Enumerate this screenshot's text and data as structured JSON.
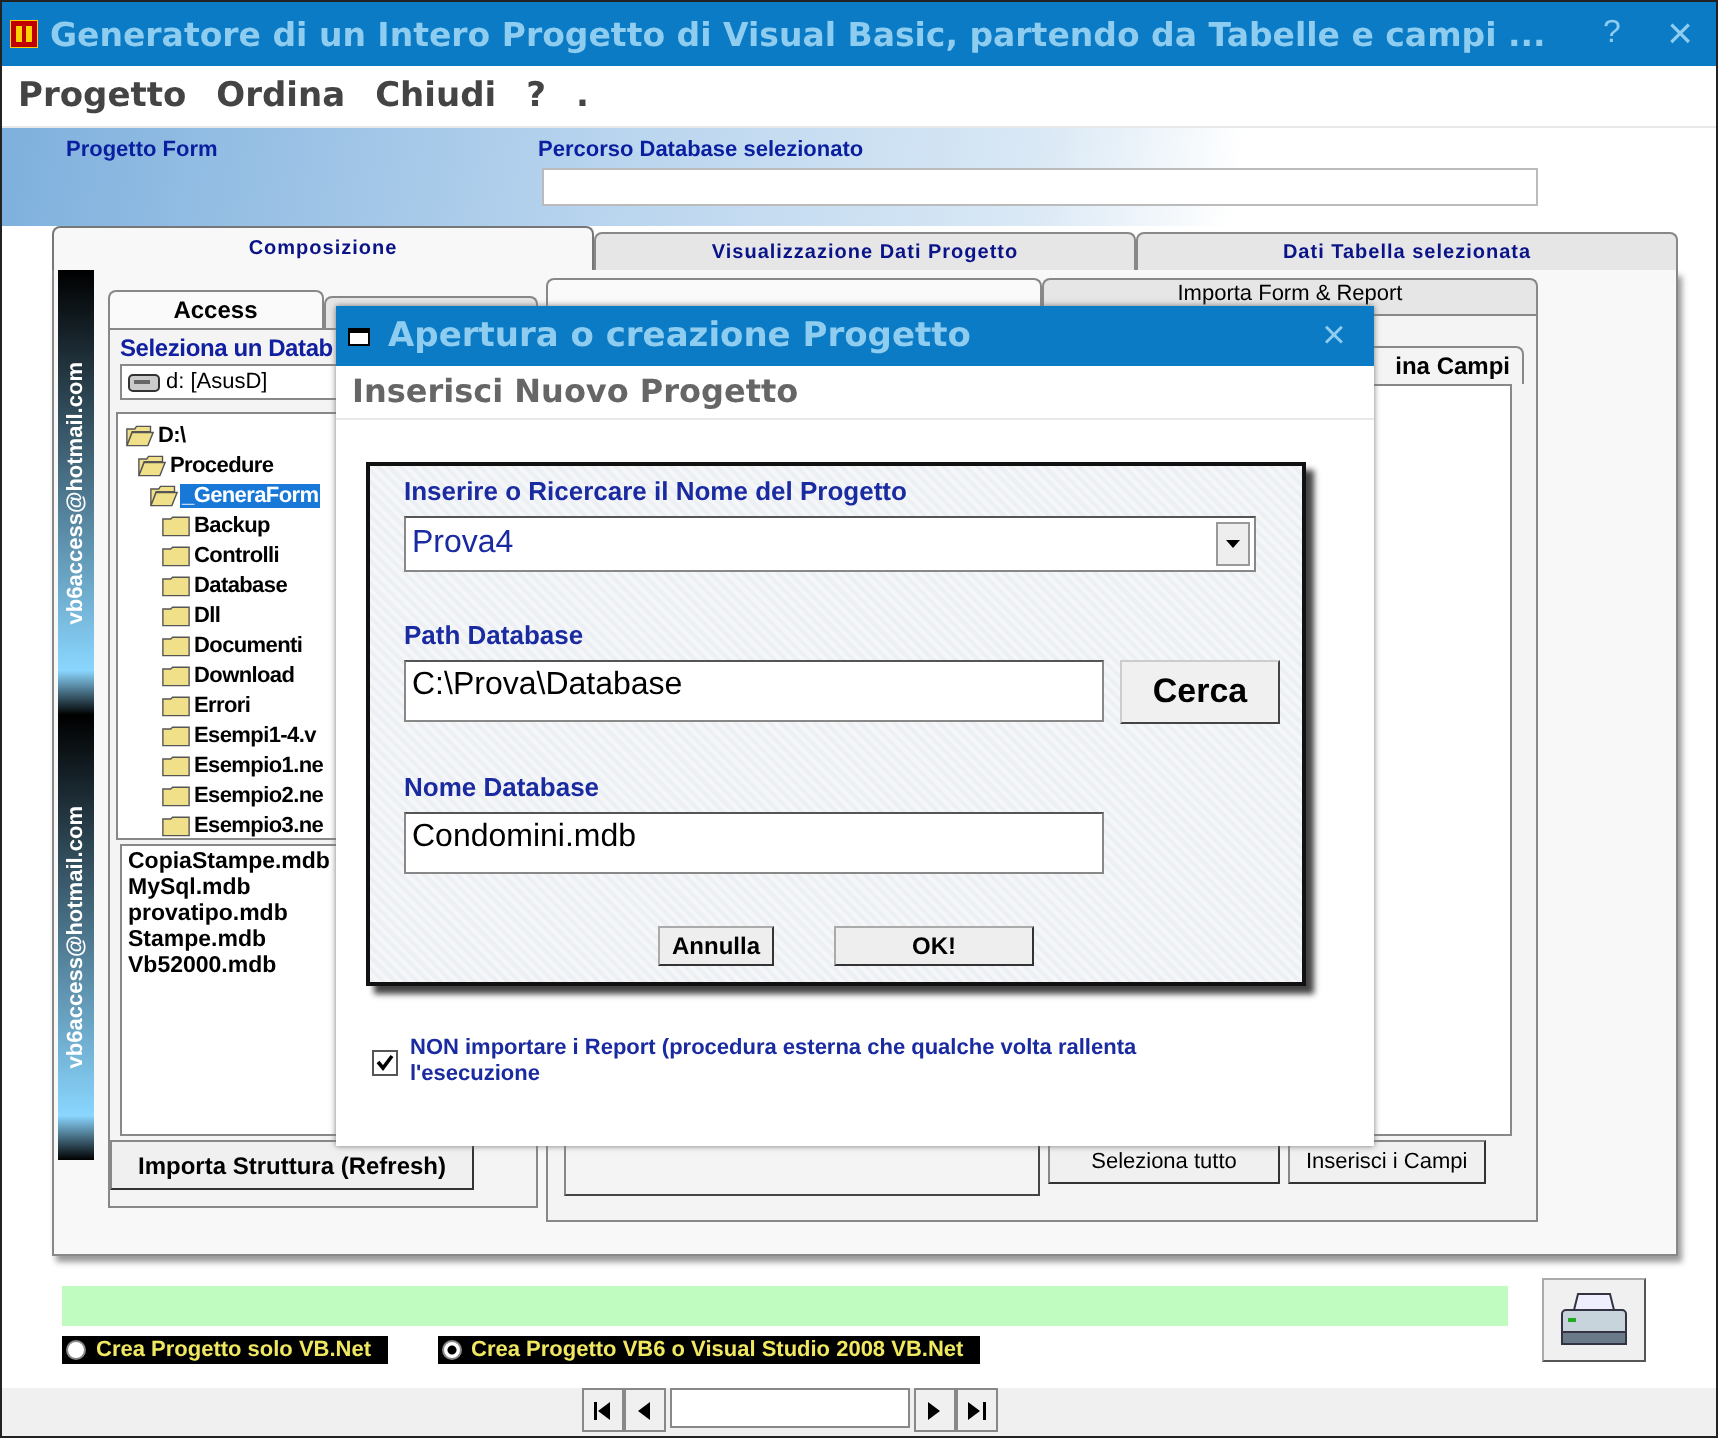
{
  "window": {
    "title": "Generatore di un Intero Progetto di Visual Basic, partendo da Tabelle e campi ...",
    "help": "?",
    "close": "×"
  },
  "menu": [
    {
      "label": "Progetto"
    },
    {
      "label": "Ordina"
    },
    {
      "label": "Chiudi"
    },
    {
      "label": "?"
    },
    {
      "label": "."
    }
  ],
  "form_label": "Progetto Form",
  "database_path": {
    "label": "Percorso Database selezionato"
  },
  "tabs": [
    {
      "label": "Composizione",
      "selected": true
    },
    {
      "label": "Visualizzazione Dati Progetto",
      "selected": false
    },
    {
      "label": "Dati Tabella selezionata",
      "selected": false
    }
  ],
  "side_strip": [
    "vb6access@hotmail.com",
    "vb6access@hotmail.com"
  ],
  "left_tabs": [
    {
      "label": "Access",
      "selected": true
    },
    {
      "selected": false
    }
  ],
  "database_select": {
    "label": "Seleziona un Datab",
    "drive": "d: [AsusD]"
  },
  "folders": [
    {
      "label": "D:\\",
      "expanded": true,
      "selected": false,
      "children": [
        {
          "label": "Procedure",
          "expanded": true,
          "selected": false,
          "children": [
            {
              "label": "_GeneraForm",
              "expanded": true,
              "selected": true,
              "children": [
                {
                  "label": "Backup",
                  "expanded": false,
                  "selected": false
                },
                {
                  "label": "Controlli",
                  "expanded": false,
                  "selected": false
                },
                {
                  "label": "Database",
                  "expanded": false,
                  "selected": false
                },
                {
                  "label": "Dll",
                  "expanded": false,
                  "selected": false
                },
                {
                  "label": "Documenti",
                  "expanded": false,
                  "selected": false
                },
                {
                  "label": "Download",
                  "expanded": false,
                  "selected": false
                },
                {
                  "label": "Errori",
                  "expanded": false,
                  "selected": false
                },
                {
                  "label": "Esempi1-4.v",
                  "expanded": false,
                  "selected": false
                },
                {
                  "label": "Esempio1.ne",
                  "expanded": false,
                  "selected": false
                },
                {
                  "label": "Esempio2.ne",
                  "expanded": false,
                  "selected": false
                },
                {
                  "label": "Esempio3.ne",
                  "expanded": false,
                  "selected": false
                }
              ]
            }
          ]
        }
      ]
    }
  ],
  "files": [
    "CopiaStampe.mdb",
    "MySql.mdb",
    "provatipo.mdb",
    "Stampe.mdb",
    "Vb52000.mdb"
  ],
  "import_button": "Importa Struttura (Refresh)",
  "right_tabs": [
    {
      "selected": true
    },
    {
      "label": "Importa Form & Report",
      "selected": false
    }
  ],
  "fields_tab": "ina Campi",
  "buttons": [
    "Seleziona tutto",
    "Inserisci i Campi"
  ],
  "radios": [
    {
      "label": "Crea Progetto solo VB.Net",
      "selected": false
    },
    {
      "label": "Crea Progetto VB6 o Visual Studio 2008 VB.Net",
      "selected": true
    }
  ],
  "dialog": {
    "title": "Apertura o creazione Progetto",
    "close": "×",
    "heading": "Inserisci Nuovo Progetto",
    "project_name": {
      "label": "Inserire o Ricercare il Nome del Progetto",
      "value": "Prova4"
    },
    "path": {
      "label": "Path Database",
      "value": "C:\\Prova\\Database"
    },
    "search_button": "Cerca",
    "db_name": {
      "label": "Nome Database",
      "value": "Condomini.mdb"
    },
    "buttons": [
      "Annulla",
      "OK!"
    ],
    "no_reports": {
      "label": "NON importare i Report (procedura esterna che qualche volta rallenta l'esecuzione",
      "checked": true
    }
  }
}
